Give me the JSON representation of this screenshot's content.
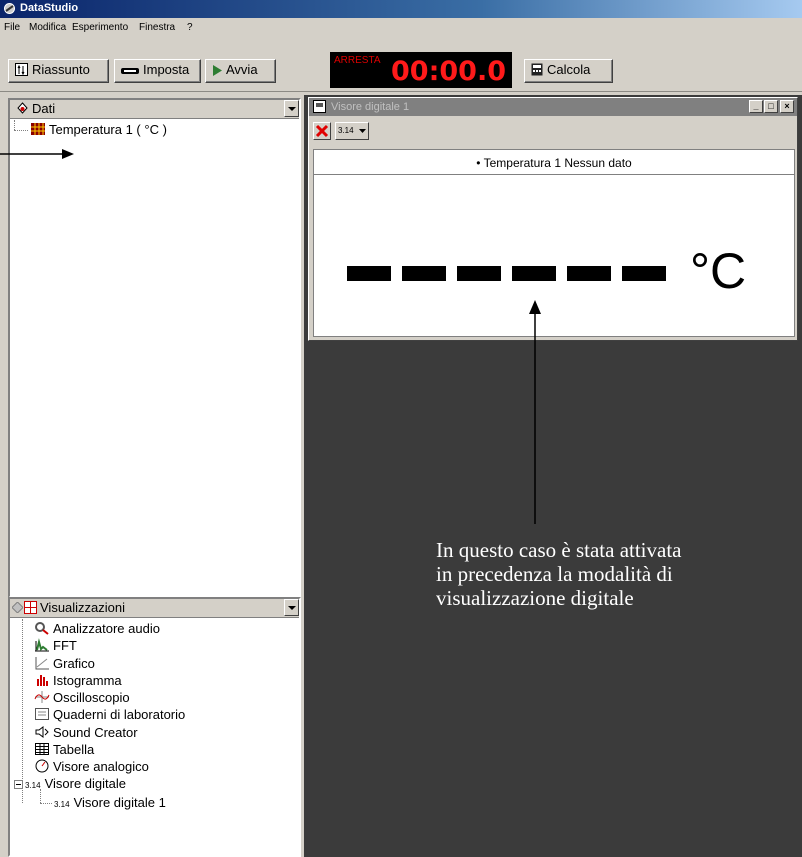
{
  "app": {
    "title": "DataStudio"
  },
  "menu": [
    "File",
    "Modifica",
    "Esperimento",
    "Finestra",
    "?"
  ],
  "toolbar": {
    "summary_label": "Riassunto",
    "setup_label": "Imposta",
    "start_label": "Avvia",
    "stop_label": "ARRESTA",
    "time": "00:00.0",
    "calc_label": "Calcola"
  },
  "data_panel": {
    "title": "Dati",
    "items": [
      {
        "label": "Temperatura 1 ( °C )"
      }
    ]
  },
  "displays_panel": {
    "title": "Visualizzazioni",
    "items": [
      {
        "label": "Analizzatore audio",
        "icon": "audio-analyzer-icon"
      },
      {
        "label": "FFT",
        "icon": "fft-icon"
      },
      {
        "label": "Grafico",
        "icon": "graph-icon"
      },
      {
        "label": "Istogramma",
        "icon": "histogram-icon"
      },
      {
        "label": "Oscilloscopio",
        "icon": "oscilloscope-icon"
      },
      {
        "label": "Quaderni di laboratorio",
        "icon": "lab-notebook-icon"
      },
      {
        "label": "Sound Creator",
        "icon": "speaker-icon"
      },
      {
        "label": "Tabella",
        "icon": "table-icon"
      },
      {
        "label": "Visore analogico",
        "icon": "analog-meter-icon"
      },
      {
        "label": "Visore digitale",
        "icon": "digital-meter-icon"
      },
      {
        "label": "Visore digitale 1",
        "icon": "digital-meter-icon"
      }
    ]
  },
  "digital_window": {
    "title": "Visore digitale 1",
    "caption": "• Temperatura 1   Nessun dato",
    "unit": "°C",
    "digits_icon_text": "3.14"
  },
  "annotation": {
    "line1": "In questo caso è stata attivata",
    "line2": "in precedenza la modalità di",
    "line3": "visualizzazione digitale"
  },
  "colors": {
    "clock_red": "#ff1a1a",
    "workspace": "#3b3b3b"
  }
}
